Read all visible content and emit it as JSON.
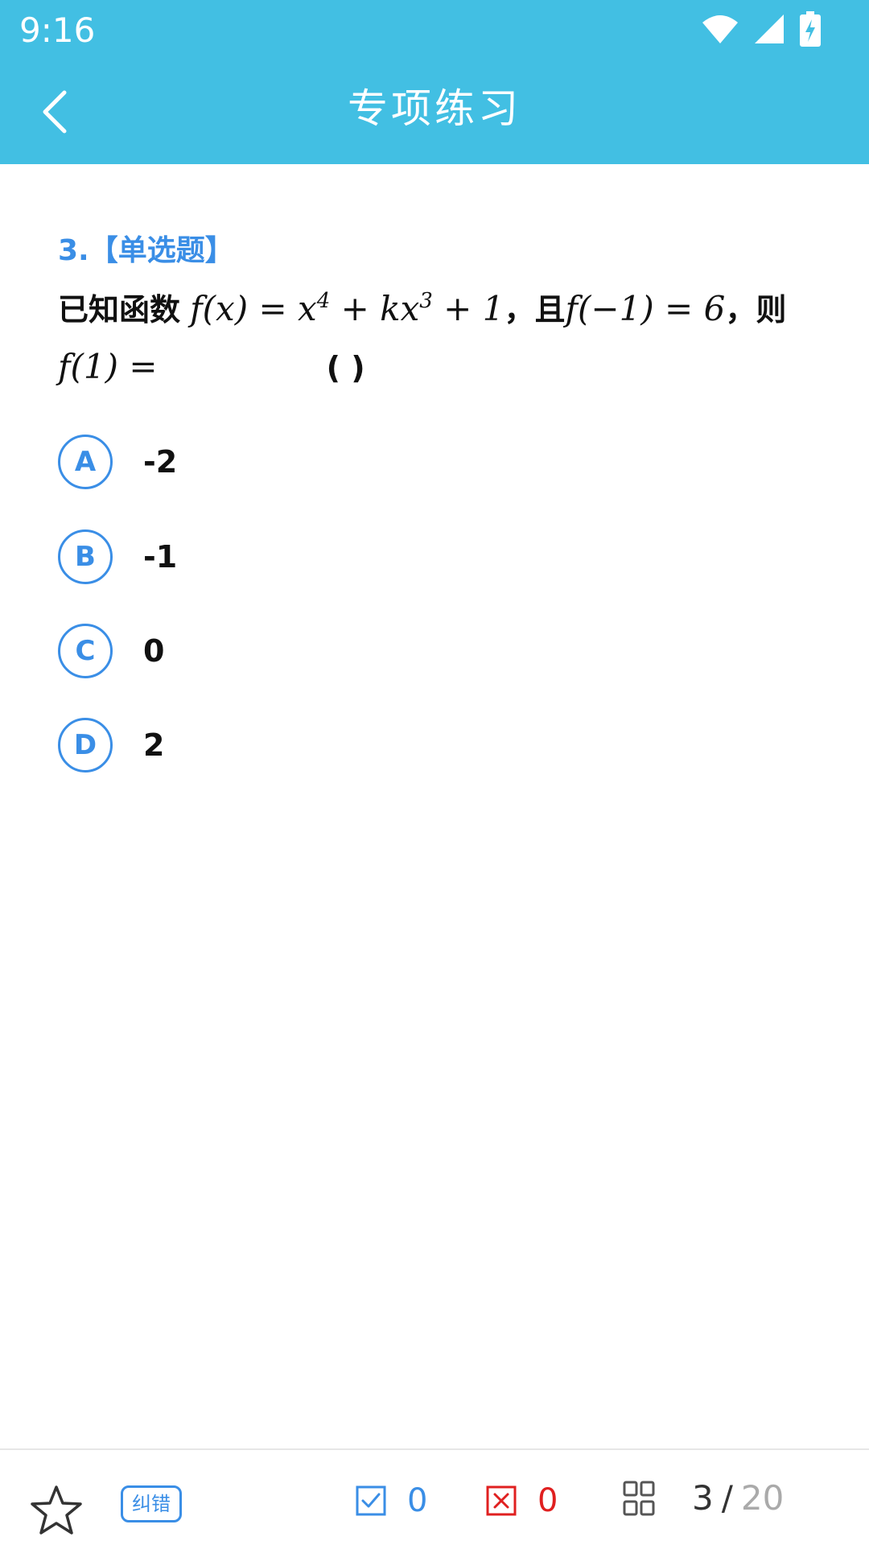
{
  "status_bar": {
    "time": "9:16",
    "icons": [
      "wifi-icon",
      "signal-icon",
      "battery-charging-icon"
    ]
  },
  "header": {
    "back_icon": "chevron-left-icon",
    "title": "专项练习",
    "background_color": "#42bfe3"
  },
  "question": {
    "number_label": "3.【单选题】",
    "text_prefix": "已知函数",
    "expr1": "f(x) = x",
    "exp1": "4",
    "expr1b": " + kx",
    "exp2": "3",
    "expr1c": " + 1",
    "conj1": "，且",
    "expr2": "f(−1) = 6",
    "conj2": "，则",
    "expr3": "f(1) =",
    "paren": "(    )"
  },
  "options": [
    {
      "letter": "A",
      "text": "-2"
    },
    {
      "letter": "B",
      "text": "-1"
    },
    {
      "letter": "C",
      "text": "0"
    },
    {
      "letter": "D",
      "text": "2"
    }
  ],
  "bottom_bar": {
    "favorite_icon": "star-outline-icon",
    "correct_label": "纠错",
    "right_count": "0",
    "wrong_count": "0",
    "grid_icon": "grid-icon",
    "current_page": "3",
    "separator": "/",
    "total_pages": "20",
    "accent_color": "#3a8ee6",
    "wrong_color": "#e02020"
  }
}
